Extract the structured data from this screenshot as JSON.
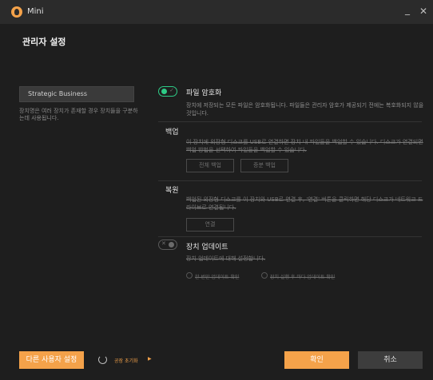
{
  "window": {
    "app_title": "Mini",
    "minimize_label": "_",
    "close_label": "✕"
  },
  "page_title": "관리자 설정",
  "left": {
    "device_name_value": "Strategic Business",
    "help_text": "장치명은 여러 장치가 존재할 경우 장치들을 구분하는데 사용됩니다."
  },
  "sections": {
    "encryption": {
      "title": "파일 암호화",
      "desc": "장치에 저장되는 모든 파일은 암호화됩니다. 파일들은 관리자 암호가 제공되기 전에는 복호화되지 않을 것입니다.",
      "toggle_state": "on",
      "toggle_mark": "✓"
    },
    "backup": {
      "title": "백업",
      "desc": "이 장치에 외장형 디스크를 USB로 연결하면 장치 내 파일들을 백업할 수 있습니다. 디스크가 연결되면 백업 방법을 선택하여 파일들을 백업할 수 있습니다.",
      "full_backup_label": "전체 백업",
      "incremental_backup_label": "증분 백업"
    },
    "restore": {
      "title": "복원",
      "desc": "백업된 외장형 디스크를 이 장치와 USB로 연결 후, '연결' 버튼을 클릭하면 해당 디스크가 네트워크 드라이브로 연결됩니다.",
      "connect_label": "연결"
    },
    "update": {
      "title": "장치 업데이트",
      "desc": "장치 업데이트에 대해 설정합니다.",
      "toggle_state": "off",
      "toggle_mark": "✕",
      "option_daily": "한 번만 업데이트 확인",
      "option_boot": "장치 실행 후 마다 업데이트 확인"
    }
  },
  "footer": {
    "other_user_settings_label": "다른 사용자 설정",
    "factory_reset_label": "공장 초기화",
    "factory_reset_arrow": "▶",
    "confirm_label": "확인",
    "cancel_label": "취소"
  },
  "colors": {
    "accent": "#f4a24a",
    "toggle_on": "#2ecc87",
    "background": "#1e1e1e",
    "titlebar": "#2b2b2b"
  }
}
